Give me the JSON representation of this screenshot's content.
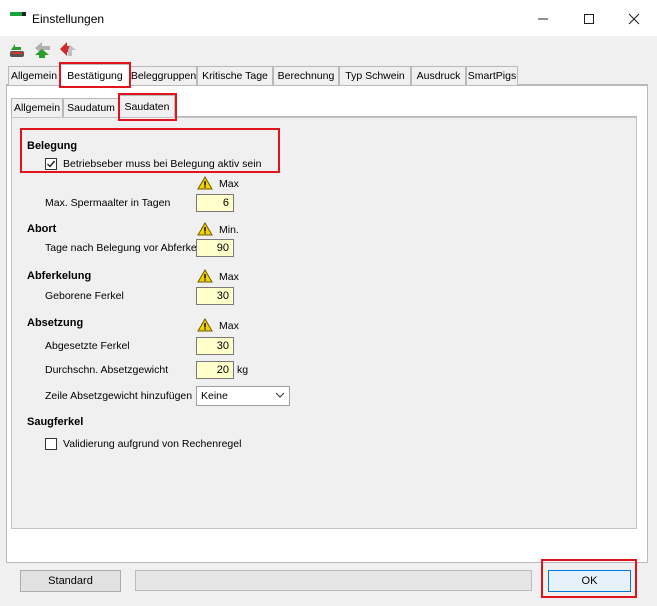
{
  "window": {
    "title": "Einstellungen",
    "minimize_glyph": "—",
    "maximize_glyph": "☐",
    "close_glyph": "✕"
  },
  "toolbar": {
    "icons": [
      "save-icon",
      "refresh-icon",
      "reset-icon"
    ]
  },
  "tabs": {
    "main": [
      "Allgemein",
      "Bestätigung",
      "Beleggruppen",
      "Kritische Tage",
      "Berechnung",
      "Typ Schwein",
      "Ausdruck",
      "SmartPigs"
    ],
    "main_active": "Bestätigung",
    "sub": [
      "Allgemein",
      "Saudatum",
      "Saudaten"
    ],
    "sub_active": "Saudaten"
  },
  "belegung": {
    "heading": "Belegung",
    "checkbox_label": "Betriebseber muss bei Belegung aktiv sein",
    "checkbox_checked": true,
    "limit_label": "Max",
    "field_label": "Max. Spermaalter in Tagen",
    "field_value": "6"
  },
  "abort": {
    "heading": "Abort",
    "limit_label": "Min.",
    "field_label": "Tage nach Belegung vor Abferkeln",
    "field_value": "90"
  },
  "abferkelung": {
    "heading": "Abferkelung",
    "limit_label": "Max",
    "field_label": "Geborene Ferkel",
    "field_value": "30"
  },
  "absetzung": {
    "heading": "Absetzung",
    "limit_label": "Max",
    "field1_label": "Abgesetzte Ferkel",
    "field1_value": "30",
    "field2_label": "Durchschn. Absetzgewicht",
    "field2_value": "20",
    "field2_unit": "kg",
    "select_label": "Zeile Absetzgewicht hinzufügen",
    "select_value": "Keine"
  },
  "saugferkel": {
    "heading": "Saugferkel",
    "checkbox_label": "Validierung aufgrund von Rechenregel",
    "checkbox_checked": false
  },
  "footer": {
    "standard_label": "Standard",
    "ok_label": "OK"
  },
  "colors": {
    "highlight": "#e0141c",
    "input_bg": "#ffffcc",
    "warning": "#f2d200"
  }
}
